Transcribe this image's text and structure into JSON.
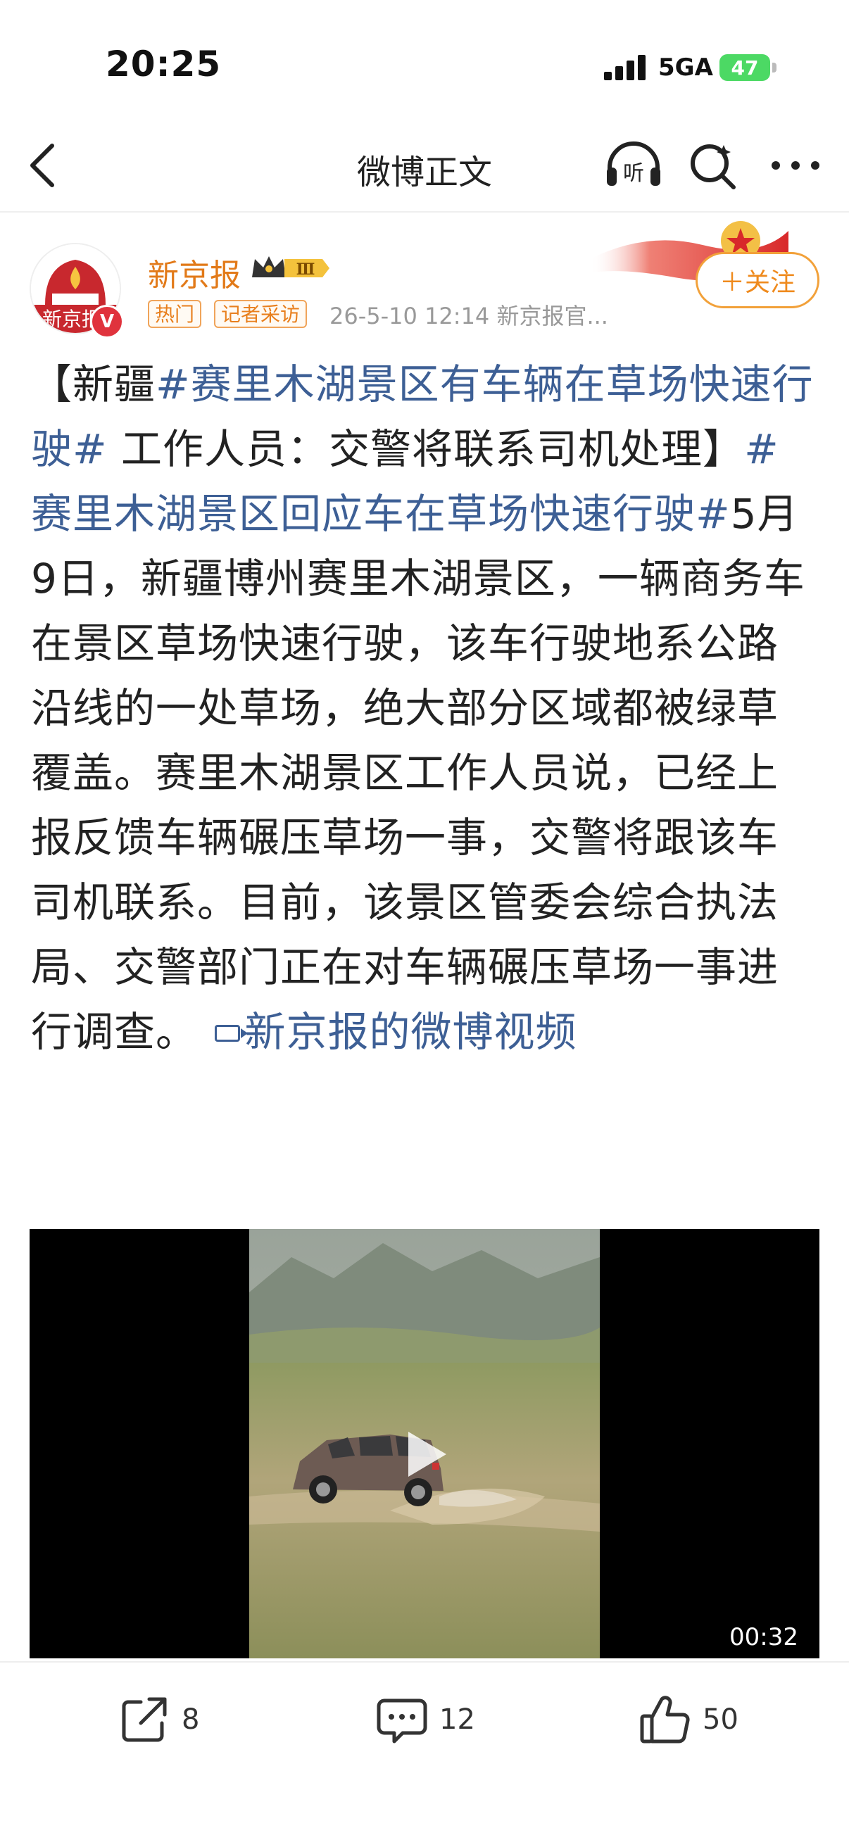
{
  "status_bar": {
    "time": "20:25",
    "network": "5GA",
    "battery": "47"
  },
  "nav": {
    "title": "微博正文",
    "listen_label": "听"
  },
  "author": {
    "name": "新京报",
    "avatar_text": "新京报",
    "verified_badge": "V",
    "level_badge": "Ⅲ",
    "tags": [
      "热门",
      "记者采访"
    ],
    "meta": "26-5-10 12:14  新京报官...",
    "follow_label": "＋关注"
  },
  "post": {
    "segments": [
      {
        "text": "【新疆",
        "type": "plain"
      },
      {
        "text": "#赛里木湖景区有车辆在草场快速行驶#",
        "type": "topic"
      },
      {
        "text": " 工作人员：交警将联系司机处理】",
        "type": "plain"
      },
      {
        "text": "#赛里木湖景区回应车在草场快速行驶#",
        "type": "topic"
      },
      {
        "text": "5月9日，新疆博州赛里木湖景区，一辆商务车在景区草场快速行驶，该车行驶地系公路沿线的一处草场，绝大部分区域都被绿草覆盖。赛里木湖景区工作人员说，已经上报反馈车辆碾压草场一事，交警将跟该车司机联系。目前，该景区管委会综合执法局、交警部门正在对车辆碾压草场一事进行调查。 ",
        "type": "plain"
      },
      {
        "text": "新京报的微博视频",
        "type": "video_link"
      }
    ]
  },
  "video": {
    "duration": "00:32"
  },
  "actions": {
    "share_count": "8",
    "comment_count": "12",
    "like_count": "50"
  },
  "colors": {
    "accent_orange": "#ef8a1d",
    "link_blue": "#3d5f95",
    "battery_green": "#4cd964"
  }
}
